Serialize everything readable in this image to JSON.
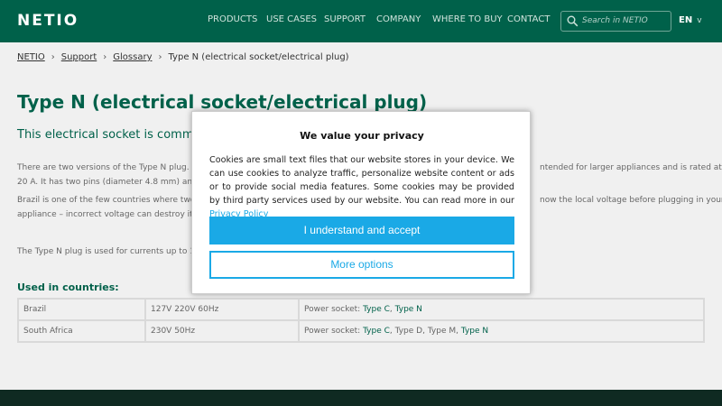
{
  "header": {
    "logo": "NETIO",
    "nav": [
      "PRODUCTS",
      "USE CASES",
      "SUPPORT",
      "COMPANY",
      "WHERE TO BUY",
      "CONTACT"
    ],
    "search_placeholder": "Search in NETIO",
    "lang": "EN",
    "lang_chevron": "v"
  },
  "breadcrumb": {
    "items": [
      "NETIO",
      "Support",
      "Glossary"
    ],
    "current": "Type N (electrical socket/electrical plug)",
    "sep": "›"
  },
  "main": {
    "title": "Type N (electrical socket/electrical plug)",
    "subtitle": "This electrical socket is common in: B",
    "p1a": "There are two versions of the Type N plug. On",
    "p1b": "ntended for larger appliances and is rated at",
    "p1c": "20 A. It has two pins (diameter 4.8 mm) and an",
    "p2a": "Brazil is one of the few countries where two vo",
    "p2b": "now the local voltage before plugging in your",
    "p2c": "appliance – incorrect voltage can destroy it! M",
    "p3": "The Type N plug is used for currents up to 10/",
    "countries_heading": "Used in countries:",
    "table": [
      {
        "country": "Brazil",
        "voltage": "127V 220V 60Hz",
        "socket_prefix": "Power socket: ",
        "types": [
          {
            "t": "Type C",
            "link": true
          },
          {
            "t": ", ",
            "link": false
          },
          {
            "t": "Type N",
            "link": true
          }
        ]
      },
      {
        "country": "South Africa",
        "voltage": "230V 50Hz",
        "socket_prefix": "Power socket: ",
        "types": [
          {
            "t": "Type C",
            "link": true
          },
          {
            "t": ", Type D, Type M, ",
            "link": false
          },
          {
            "t": "Type N",
            "link": true
          }
        ]
      }
    ]
  },
  "modal": {
    "title": "We value your privacy",
    "text": "Cookies are small text files that our website stores in your device. We can use cookies to analyze traffic, personalize website content or ads or to provide social media features. Some cookies may be provided by third party services used by our website. You can read more in our",
    "link": "Privacy Policy",
    "accept": "I understand and accept",
    "more": "More options"
  },
  "colors": {
    "brand_green": "#00614a",
    "accent_blue": "#1aa9e6",
    "footer": "#0f2a22"
  },
  "icons": [
    "search-icon",
    "chevron-down-icon",
    "chevron-right-icon"
  ]
}
